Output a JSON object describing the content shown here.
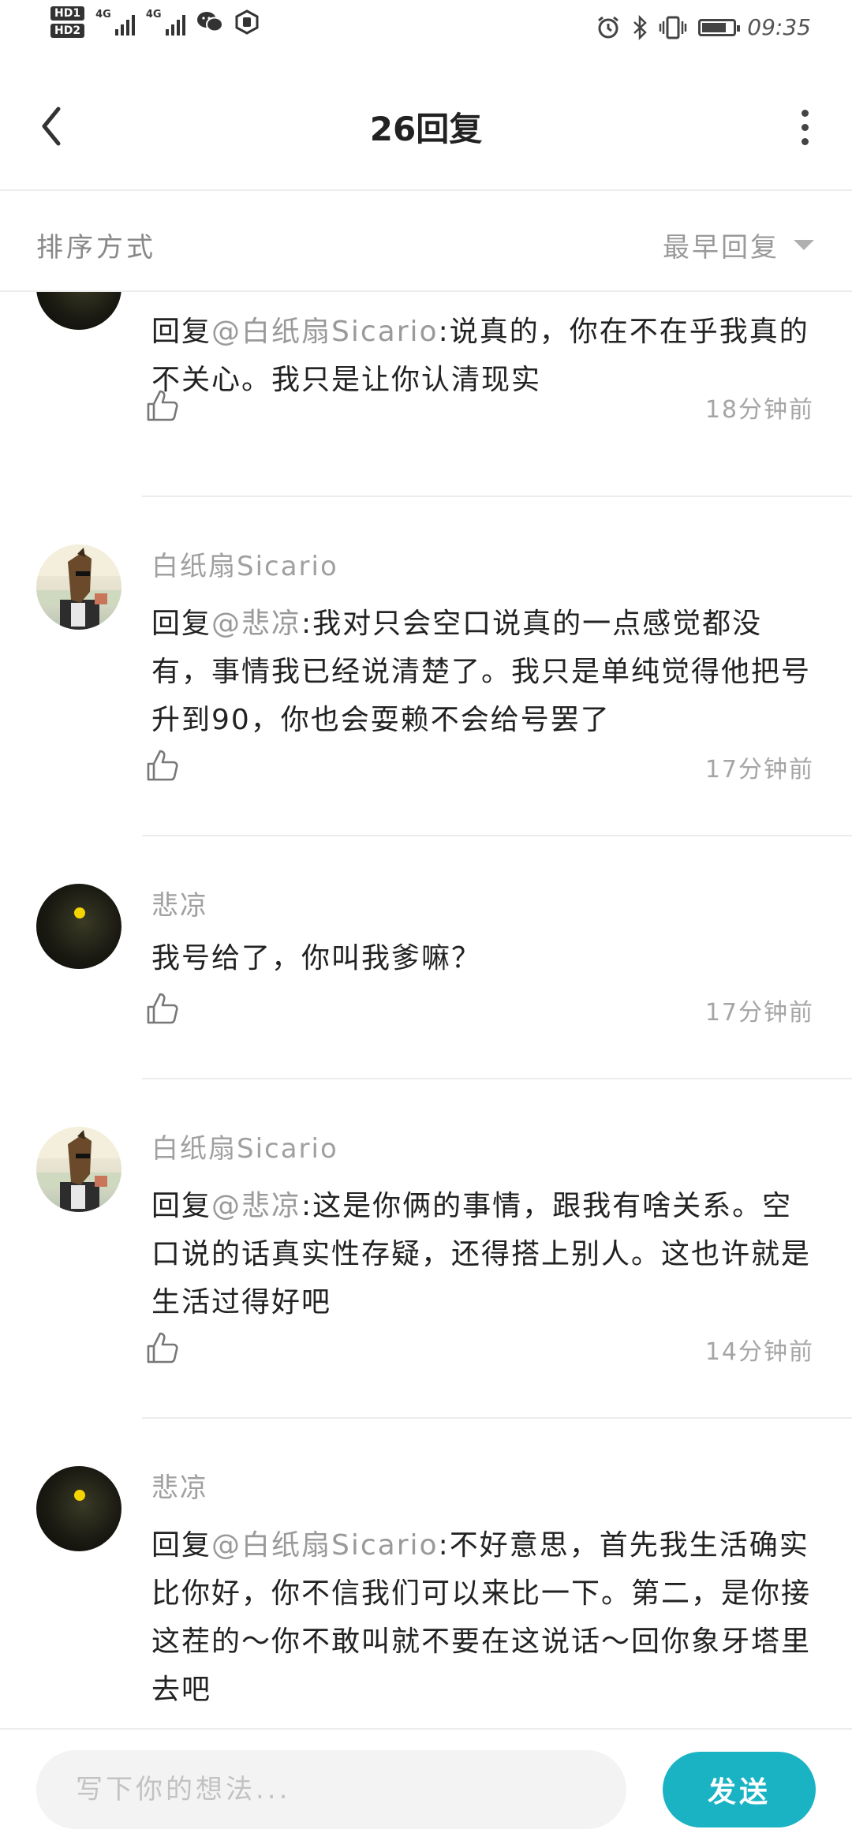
{
  "status_bar": {
    "hd1": "HD1",
    "hd2": "HD2",
    "net1": "4G",
    "net2": "4G",
    "time": "09:35",
    "battery_level": 0.8,
    "icons": [
      "wechat-icon",
      "hexagon-app-icon",
      "alarm-icon",
      "bluetooth-icon",
      "vibrate-icon",
      "battery-icon"
    ]
  },
  "header": {
    "title": "26回复",
    "back_icon": "chevron-left-icon",
    "more_icon": "more-vertical-icon"
  },
  "sort": {
    "label": "排序方式",
    "selected": "最早回复"
  },
  "comments": [
    {
      "author": "",
      "avatar": "dark",
      "reply_prefix": "回复",
      "mention": "@白纸扇Sicario",
      "body": ":说真的，你在不在乎我真的不关心。我只是让你认清现实",
      "time": "18分钟前"
    },
    {
      "author": "白纸扇Sicario",
      "avatar": "horse",
      "reply_prefix": "回复",
      "mention": "@悲凉",
      "body": ":我对只会空口说真的一点感觉都没有，事情我已经说清楚了。我只是单纯觉得他把号升到90，你也会耍赖不会给号罢了",
      "time": "17分钟前"
    },
    {
      "author": "悲凉",
      "avatar": "dark",
      "reply_prefix": "",
      "mention": "",
      "body": "我号给了，你叫我爹嘛？",
      "time": "17分钟前"
    },
    {
      "author": "白纸扇Sicario",
      "avatar": "horse",
      "reply_prefix": "回复",
      "mention": "@悲凉",
      "body": ":这是你俩的事情，跟我有啥关系。空口说的话真实性存疑，还得搭上别人。这也许就是生活过得好吧",
      "time": "14分钟前"
    },
    {
      "author": "悲凉",
      "avatar": "dark",
      "reply_prefix": "回复",
      "mention": "@白纸扇Sicario",
      "body": ":不好意思，首先我生活确实比你好，你不信我们可以来比一下。第二，是你接这茬的～你不敢叫就不要在这说话～回你象牙塔里去吧",
      "time": ""
    }
  ],
  "composer": {
    "placeholder": "写下你的想法...",
    "send_label": "发送",
    "send_color": "#1ab3c4"
  }
}
